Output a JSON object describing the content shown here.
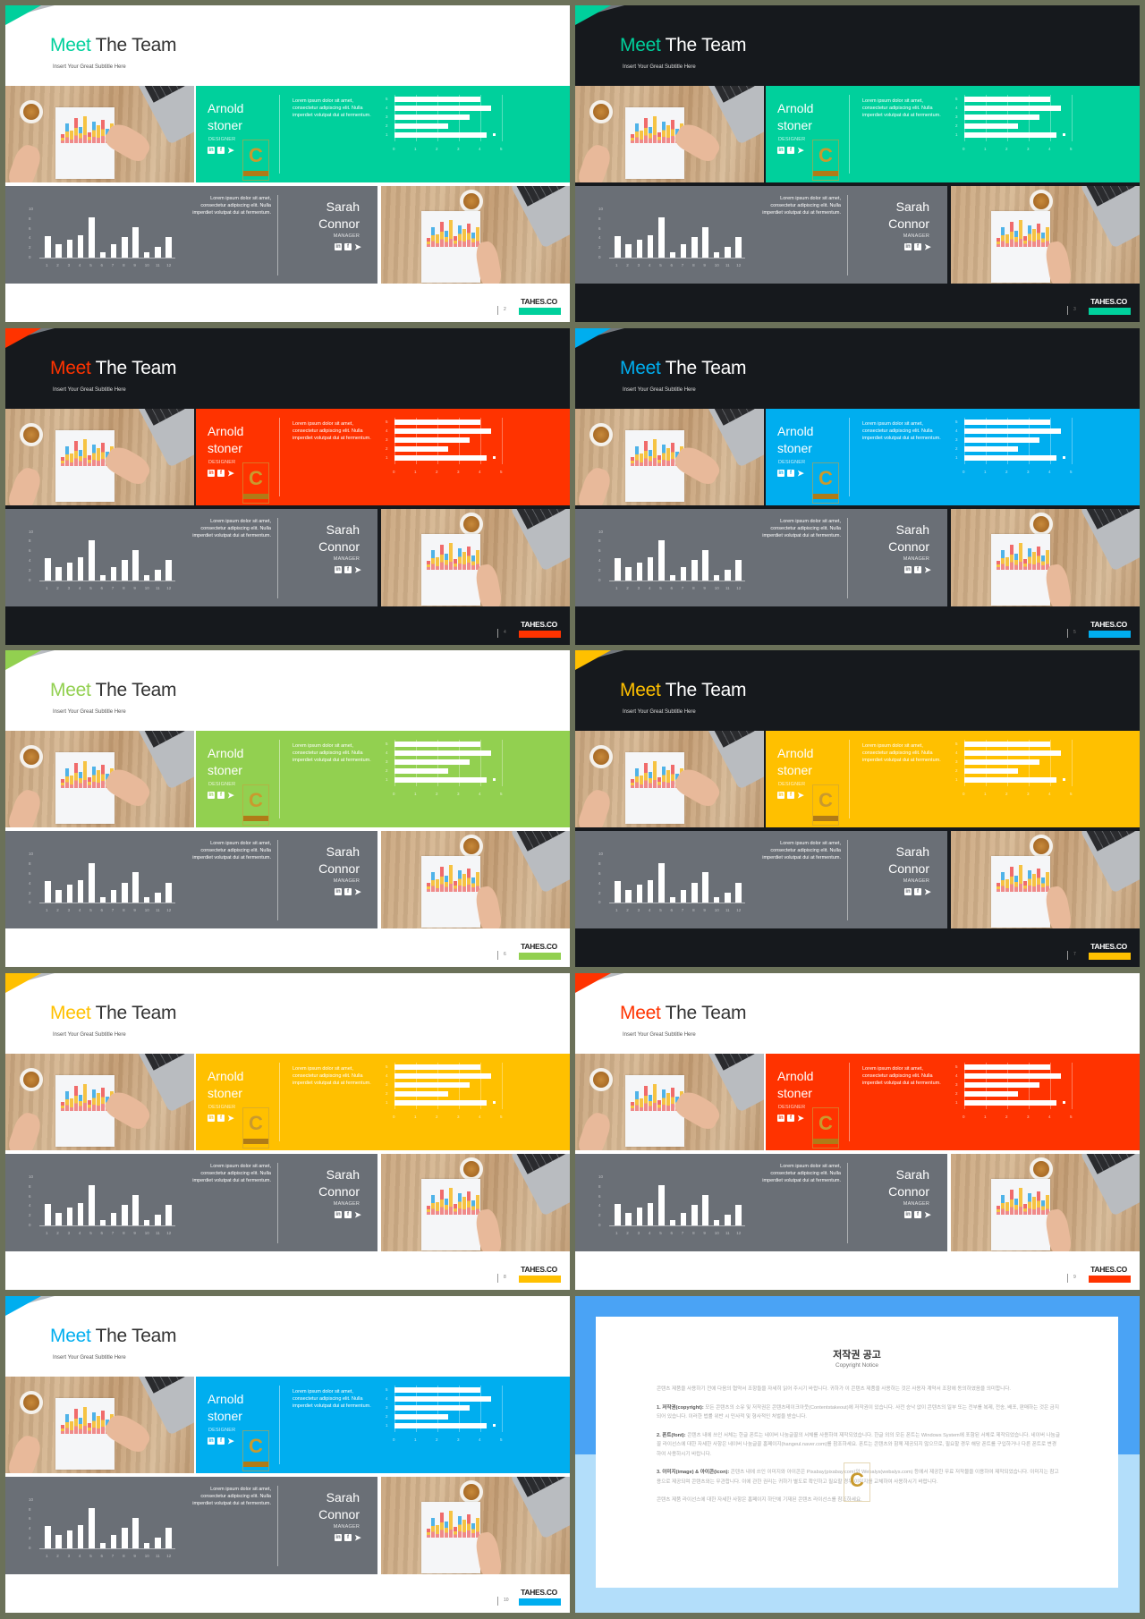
{
  "common": {
    "title_accent": "Meet",
    "title_rest": " The Team",
    "subtitle": "Insert Your Great Subtitle Here",
    "member1": {
      "first": "Arnold",
      "last": "stoner",
      "role": "DESIGNER"
    },
    "member2": {
      "first": "Sarah",
      "last": "Connor",
      "role": "MANAGER"
    },
    "lorem": "Lorem ipsum dolor sit amet, consectetur adipiscing elit. Nulla imperdiet volutpat dui at fermentum.",
    "social": {
      "linkedin": "in",
      "facebook": "f",
      "twitter": "🐦"
    },
    "brand": "TAHES.CO",
    "watermark": "C"
  },
  "slides": [
    {
      "page": "2",
      "theme": "light",
      "accent": "#00d09c"
    },
    {
      "page": "3",
      "theme": "dark",
      "accent": "#00d09c"
    },
    {
      "page": "4",
      "theme": "dark",
      "accent": "#ff3300"
    },
    {
      "page": "5",
      "theme": "dark",
      "accent": "#00aeef"
    },
    {
      "page": "6",
      "theme": "light",
      "accent": "#92d050"
    },
    {
      "page": "7",
      "theme": "dark",
      "accent": "#ffc000"
    },
    {
      "page": "8",
      "theme": "light",
      "accent": "#ffc000"
    },
    {
      "page": "9",
      "theme": "light",
      "accent": "#ff3300"
    },
    {
      "page": "10",
      "theme": "light",
      "accent": "#00aeef"
    }
  ],
  "chart_data": [
    {
      "type": "bar",
      "orientation": "horizontal",
      "categories": [
        "1",
        "2",
        "3",
        "4",
        "5"
      ],
      "values": [
        4.3,
        2.5,
        3.5,
        4.5,
        4.0
      ],
      "xlim": [
        0,
        5
      ],
      "xticks": [
        "0",
        "1",
        "2",
        "3",
        "4",
        "5"
      ],
      "grid": true
    },
    {
      "type": "bar",
      "orientation": "vertical",
      "categories": [
        "1",
        "2",
        "3",
        "4",
        "5",
        "6",
        "7",
        "8",
        "9",
        "10",
        "11",
        "12"
      ],
      "values": [
        4.5,
        2.7,
        3.7,
        4.7,
        8.3,
        1.1,
        2.7,
        4.2,
        6.3,
        1.1,
        2.2,
        4.2
      ],
      "ylim": [
        0,
        10
      ],
      "yticks": [
        "0",
        "2",
        "4",
        "6",
        "8",
        "10"
      ],
      "grid": false
    }
  ],
  "notice": {
    "title": "저작권 공고",
    "subtitle": "Copyright Notice",
    "intro": "콘텐츠 제품을 사용하기 전에 다음의 협약서 조항들을 자세히 읽어 주시기 바랍니다. 귀하가 이 콘텐츠 제품을 사용하는 것은 사용자 계약서 조항에 동의하였음을 의미합니다.",
    "items": [
      {
        "head": "1. 저작권(copyright):",
        "text": " 모든 콘텐츠의 소유 및 저작권은 콘텐츠테이크아웃(Contentstakeout)에 저작권이 있습니다. 사전 승낙 없이 콘텐츠의 일부 또는 전부를 복제, 전송, 배포, 판매하는 것은 금지되어 있습니다. 이러한 법률 위반 시 민사적 및 형사적인 처벌을 받습니다."
      },
      {
        "head": "2. 폰트(font):",
        "text": " 콘텐츠 내에 쓰인 서체는 한글 폰트는 네이버 나눔글꼴의 서체를 사용하여 제작되었습니다. 한글 외의 모든 폰트는 Windows System에 포함된 서체로 제작되었습니다. 네이버 나눔글꼴 라이선스에 대한 자세한 사항은 네이버 나눔글꼴 홈페이지(hangeul.naver.com)를 참조하세요. 폰트는 콘텐츠와 함께 제공되지 않으므로, 필요할 경우 해당 폰트를 구입하거나 다른 폰트로 변경하여 사용하시기 바랍니다."
      },
      {
        "head": "3. 이미지(image) & 아이콘(icon):",
        "text": " 콘텐츠 내에 쓰인 이미지와 아이콘은 Pixabay(pixabay.com)와 Webalys(webalys.com) 등에서 제공한 무료 저작물을 이용하여 제작되었습니다. 이미지는 참고용으로 제공되며 콘텐츠와는 무관합니다. 이에 관한 권리는 귀하가 별도로 확인하고 필요할 경우 이미지를 교체하여 사용하시기 바랍니다."
      }
    ],
    "outro": "콘텐츠 제품 라이선스에 대한 자세한 사항은 홈페이지 하단에 기재된 콘텐츠 라이선스를 참조하세요.",
    "watermark": "C"
  }
}
